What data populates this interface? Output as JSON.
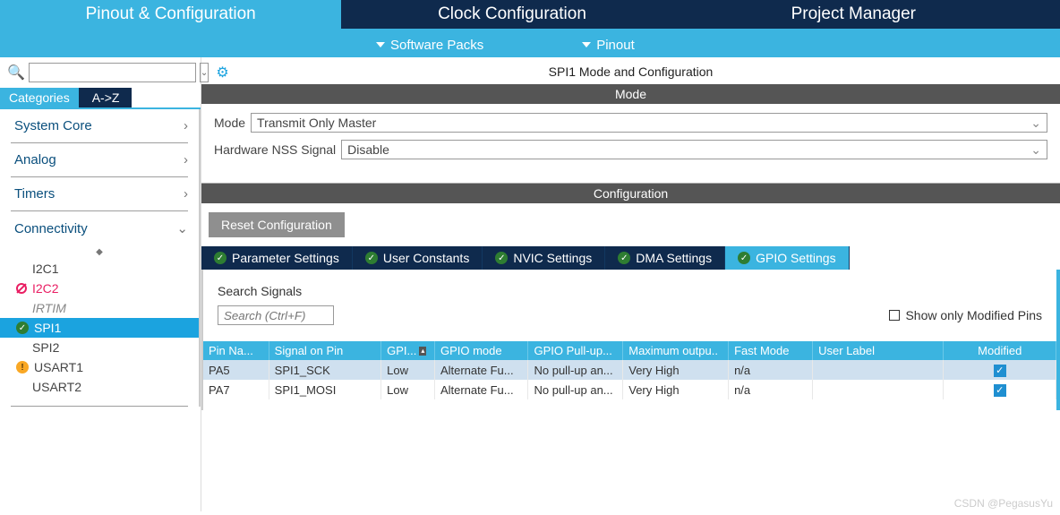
{
  "main_tabs": {
    "pinout": "Pinout & Configuration",
    "clock": "Clock Configuration",
    "project": "Project Manager"
  },
  "ribbon": {
    "software_packs": "Software Packs",
    "pinout": "Pinout"
  },
  "sidebar": {
    "search_placeholder": "",
    "cat_tabs": {
      "categories": "Categories",
      "az": "A->Z"
    },
    "groups": {
      "system_core": "System Core",
      "analog": "Analog",
      "timers": "Timers",
      "connectivity": "Connectivity"
    },
    "connectivity_items": [
      {
        "label": "I2C1",
        "status": ""
      },
      {
        "label": "I2C2",
        "status": "error"
      },
      {
        "label": "IRTIM",
        "status": ""
      },
      {
        "label": "SPI1",
        "status": "ok"
      },
      {
        "label": "SPI2",
        "status": ""
      },
      {
        "label": "USART1",
        "status": "warn"
      },
      {
        "label": "USART2",
        "status": ""
      }
    ]
  },
  "main": {
    "panel_title": "SPI1 Mode and Configuration",
    "mode_header": "Mode",
    "mode_label": "Mode",
    "mode_value": "Transmit Only Master",
    "nss_label": "Hardware NSS Signal",
    "nss_value": "Disable",
    "conf_header": "Configuration",
    "reset_btn": "Reset Configuration",
    "cfg_tabs": {
      "param": "Parameter Settings",
      "user": "User Constants",
      "nvic": "NVIC Settings",
      "dma": "DMA Settings",
      "gpio": "GPIO Settings"
    },
    "search_signals_label": "Search Signals",
    "search_signals_placeholder": "Search (Ctrl+F)",
    "show_mod": "Show only Modified Pins",
    "table": {
      "headers": {
        "pin": "Pin Na...",
        "signal": "Signal on Pin",
        "gpio_out": "GPI...",
        "gpio_mode": "GPIO mode",
        "pull": "GPIO Pull-up...",
        "max": "Maximum outpu..",
        "fast": "Fast Mode",
        "user": "User Label",
        "mod": "Modified"
      },
      "rows": [
        {
          "pin": "PA5",
          "signal": "SPI1_SCK",
          "gpio_out": "Low",
          "gpio_mode": "Alternate Fu...",
          "pull": "No pull-up an...",
          "max": "Very High",
          "fast": "n/a",
          "user": "",
          "mod": true
        },
        {
          "pin": "PA7",
          "signal": "SPI1_MOSI",
          "gpio_out": "Low",
          "gpio_mode": "Alternate Fu...",
          "pull": "No pull-up an...",
          "max": "Very High",
          "fast": "n/a",
          "user": "",
          "mod": true
        }
      ]
    }
  },
  "watermark": "CSDN @PegasusYu"
}
